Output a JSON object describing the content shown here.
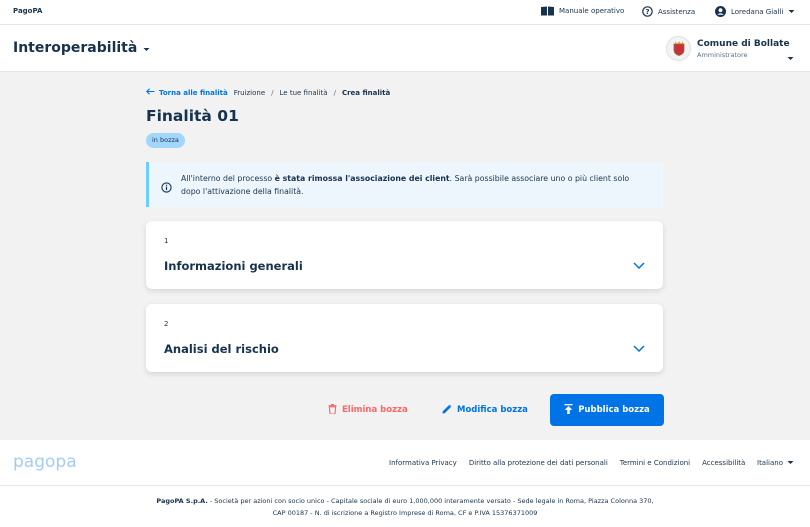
{
  "topbar": {
    "brand": "PagoPA",
    "manual": "Manuale operativo",
    "support": "Assistenza",
    "user": "Loredana Gialli"
  },
  "header": {
    "product": "Interoperabilità",
    "party_name": "Comune di Bollate",
    "party_role": "Amministratore"
  },
  "breadcrumb": {
    "back": "Torna alle finalità",
    "items": [
      "Fruizione",
      "Le tue finalità",
      "Crea finalità"
    ]
  },
  "page": {
    "title": "Finalità 01",
    "status": "in bozza"
  },
  "alert": {
    "pre": "All'interno del processo ",
    "bold": "è stata rimossa l'associazione dei client",
    "post": ". Sarà possibile associare uno o più client solo dopo l'attivazione della finalità."
  },
  "steps": [
    {
      "number": "1",
      "title": "Informazioni generali"
    },
    {
      "number": "2",
      "title": "Analisi del rischio"
    }
  ],
  "actions": {
    "delete": "Elimina bozza",
    "edit": "Modifica bozza",
    "publish": "Pubblica bozza"
  },
  "footer": {
    "logo": "pagopa",
    "links": [
      "Informativa Privacy",
      "Diritto alla protezione dei dati personali",
      "Termini e Condizioni",
      "Accessibilità"
    ],
    "language": "Italiano",
    "legal_bold": "PagoPA S.p.A.",
    "legal_line1": " - Società per azioni con socio unico - Capitale sociale di euro 1,000,000 interamente versato - Sede legale in Roma, Piazza Colonna 370,",
    "legal_line2": "CAP 00187 - N. di iscrizione a Registro Imprese di Roma, CF e P.IVA 15376371009"
  },
  "colors": {
    "primary": "#0073e6",
    "danger": "#fe6666",
    "text": "#17324d",
    "chip": "#a2d6fa",
    "alert_bg": "#eef6fd",
    "background": "#f2f2f2"
  }
}
